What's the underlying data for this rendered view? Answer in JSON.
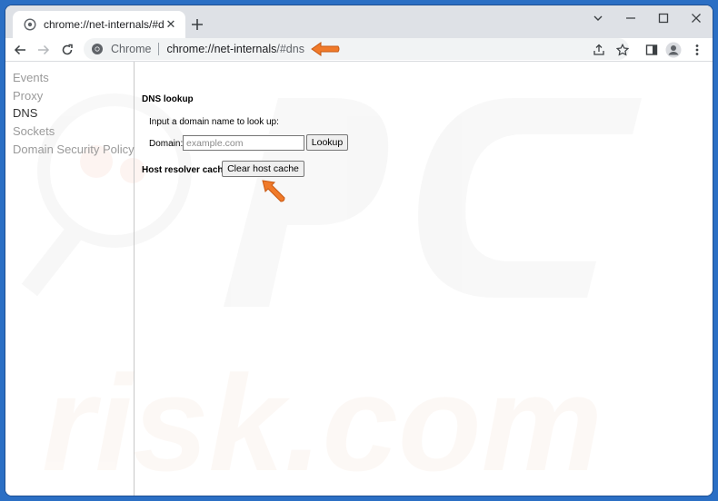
{
  "tab": {
    "title": "chrome://net-internals/#dns"
  },
  "omnibox": {
    "label": "Chrome",
    "url_host": "chrome://net-internals",
    "url_hash": "/#dns"
  },
  "sidebar": {
    "items": [
      {
        "label": "Events",
        "active": false
      },
      {
        "label": "Proxy",
        "active": false
      },
      {
        "label": "DNS",
        "active": true
      },
      {
        "label": "Sockets",
        "active": false
      },
      {
        "label": "Domain Security Policy",
        "active": false
      }
    ]
  },
  "dns_lookup": {
    "title": "DNS lookup",
    "prompt": "Input a domain name to look up:",
    "domain_label": "Domain:",
    "domain_placeholder": "example.com",
    "lookup_button": "Lookup"
  },
  "host_cache": {
    "title": "Host resolver cache",
    "clear_button": "Clear host cache"
  },
  "colors": {
    "accent_arrow": "#f07a2a",
    "frame": "#2b6fc4"
  }
}
